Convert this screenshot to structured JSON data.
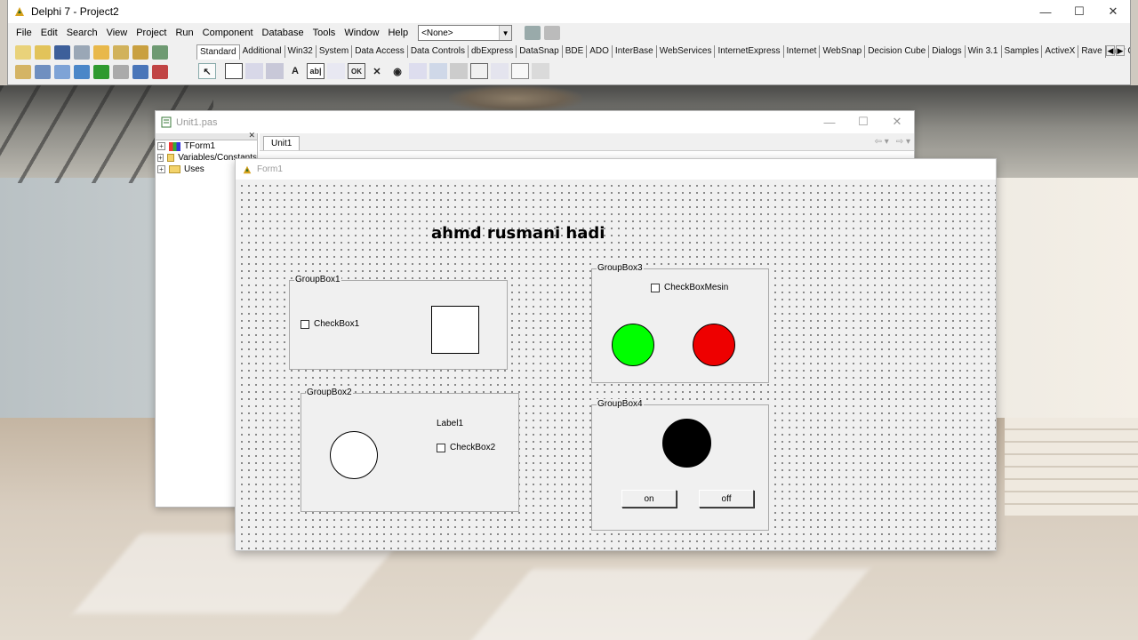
{
  "ide": {
    "title": "Delphi 7 - Project2",
    "menu": [
      "File",
      "Edit",
      "Search",
      "View",
      "Project",
      "Run",
      "Component",
      "Database",
      "Tools",
      "Window",
      "Help"
    ],
    "combo_value": "<None>",
    "palette_tabs": [
      "Standard",
      "Additional",
      "Win32",
      "System",
      "Data Access",
      "Data Controls",
      "dbExpress",
      "DataSnap",
      "BDE",
      "ADO",
      "InterBase",
      "WebServices",
      "InternetExpress",
      "Internet",
      "WebSnap",
      "Decision Cube",
      "Dialogs",
      "Win 3.1",
      "Samples",
      "ActiveX",
      "Rave",
      "Indy C"
    ],
    "active_tab": "Standard",
    "palette_glyphs": {
      "label": "A",
      "edit": "ab|",
      "checkbox": "✕",
      "radio": "◉",
      "button": "OK"
    }
  },
  "editor": {
    "title": "Unit1.pas",
    "tree": [
      {
        "label": "TForm1",
        "icon": "form-icon"
      },
      {
        "label": "Variables/Constants",
        "icon": "folder-icon"
      },
      {
        "label": "Uses",
        "icon": "folder-icon"
      }
    ],
    "tab": "Unit1"
  },
  "form": {
    "title": "Form1",
    "heading": "ahmd rusmani hadi",
    "groupbox1": {
      "caption": "GroupBox1",
      "checkbox": "CheckBox1",
      "checked": false
    },
    "groupbox2": {
      "caption": "GroupBox2",
      "label": "Label1",
      "checkbox": "CheckBox2",
      "checked": false
    },
    "groupbox3": {
      "caption": "GroupBox3",
      "checkbox": "CheckBoxMesin",
      "checked": false,
      "lamps": [
        {
          "color": "#00ff00"
        },
        {
          "color": "#ee0000"
        }
      ]
    },
    "groupbox4": {
      "caption": "GroupBox4",
      "lamp_color": "#000000",
      "on_label": "on",
      "off_label": "off"
    }
  },
  "colors": {
    "white_shape": "#ffffff"
  }
}
